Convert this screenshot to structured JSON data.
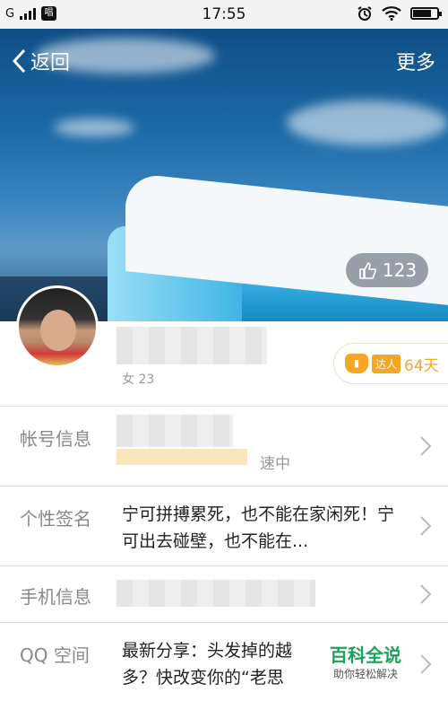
{
  "status_bar": {
    "network": "G",
    "app_icon": "唱",
    "time": "17:55"
  },
  "header": {
    "back_label": "返回",
    "more_label": "更多",
    "likes": "123"
  },
  "profile": {
    "subtitle_partial": "女 23",
    "badge_tag": "达人",
    "badge_days": "64天"
  },
  "rows": [
    {
      "label": "帐号信息",
      "value_tail": "速中"
    },
    {
      "label": "个性签名",
      "value": "宁可拼搏累死，也不能在家闲死！宁可出去碰壁，也不能在..."
    },
    {
      "label": "手机信息",
      "value": ""
    },
    {
      "label": "QQ 空间",
      "value": "最新分享：头发掉的越多？快改变你的“老思"
    }
  ],
  "watermark": {
    "title": "百科全说",
    "subtitle": "助你轻松解决"
  }
}
